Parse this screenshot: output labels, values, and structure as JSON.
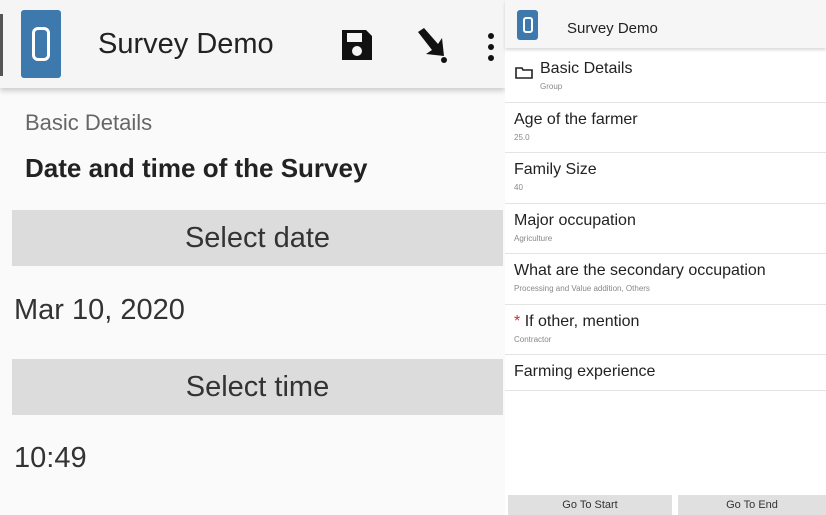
{
  "left": {
    "app_title": "Survey Demo",
    "icons": [
      "save-icon",
      "go-to-arrow-icon",
      "more-vert-icon"
    ],
    "group_label": "Basic Details",
    "question": "Date and time of the Survey",
    "select_date_label": "Select date",
    "date_value": "Mar 10, 2020",
    "select_time_label": "Select time",
    "time_value": "10:49"
  },
  "right": {
    "app_title": "Survey Demo",
    "items": [
      {
        "label": "Basic Details",
        "sub": "Group",
        "type": "group"
      },
      {
        "label": "Age of the farmer",
        "sub": "25.0"
      },
      {
        "label": "Family Size",
        "sub": "40"
      },
      {
        "label": "Major occupation",
        "sub": "Agriculture"
      },
      {
        "label": "What are the secondary occupation",
        "sub": "Processing and Value addition, Others"
      },
      {
        "label": "If other, mention",
        "sub": "Contractor",
        "required_mark": "*"
      },
      {
        "label": "Farming experience",
        "sub": ""
      }
    ],
    "go_to_start": "Go To Start",
    "go_to_end": "Go To End"
  },
  "colors": {
    "app_icon_blue": "#3d79ad",
    "button_grey": "#dcdcdc",
    "required_red": "#d32f2f"
  }
}
